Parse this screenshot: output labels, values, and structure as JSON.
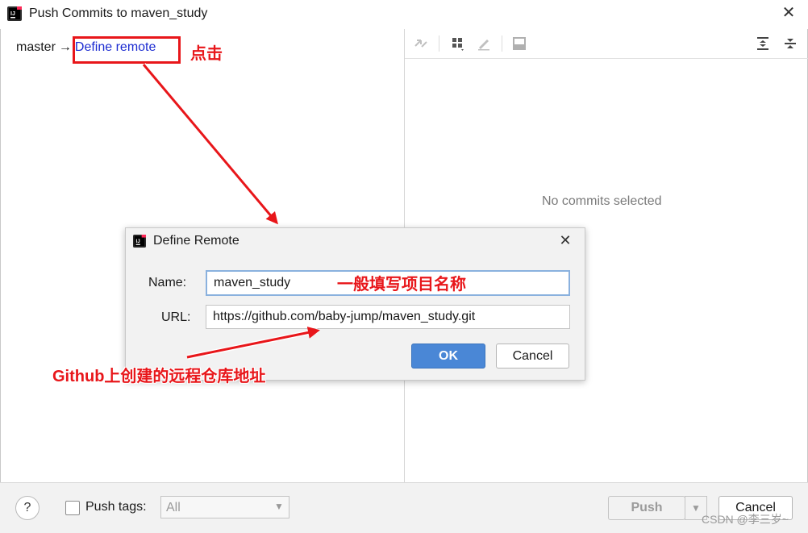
{
  "window": {
    "title": "Push Commits to maven_study",
    "close_glyph": "✕"
  },
  "left_pane": {
    "branch": "master",
    "separator": "→",
    "define_remote_link": "Define remote"
  },
  "right_pane": {
    "toolbar_icons": [
      "push-compare-icon",
      "group-icon",
      "edit-icon",
      "preview-icon",
      "expand-all-icon",
      "collapse-all-icon"
    ],
    "empty_text": "No commits selected"
  },
  "bottom_bar": {
    "help": "?",
    "push_tags_label": "Push tags:",
    "push_tags_value": "All",
    "push_button": "Push",
    "cancel_button": "Cancel",
    "watermark": "CSDN @李三岁~"
  },
  "dialog": {
    "title": "Define Remote",
    "close_glyph": "✕",
    "name_label": "Name:",
    "name_value": "maven_study",
    "url_label": "URL:",
    "url_value": "https://github.com/baby-jump/maven_study.git",
    "ok_button": "OK",
    "cancel_button": "Cancel"
  },
  "annotations": {
    "click": "点击",
    "name_hint": "一般填写项目名称",
    "url_hint": "Github上创建的远程仓库地址",
    "color": "#e8161a"
  },
  "colors": {
    "accent": "#4a87d6",
    "link": "#1b2bd1"
  }
}
